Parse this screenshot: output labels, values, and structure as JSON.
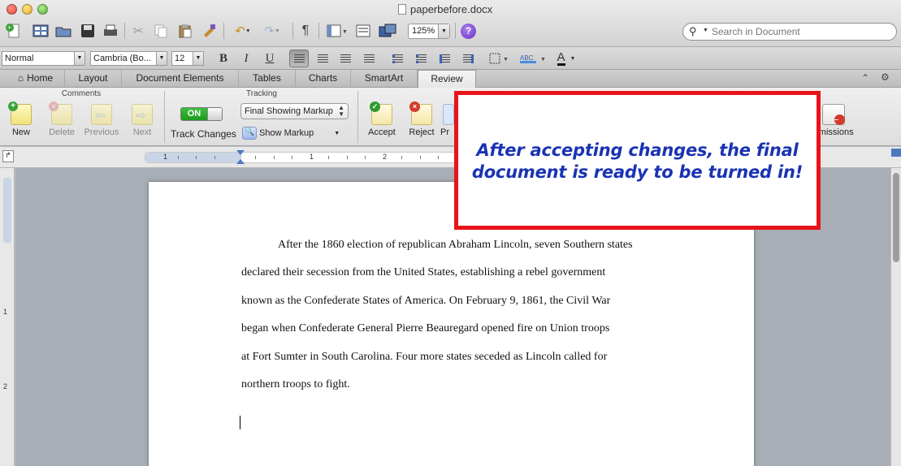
{
  "window": {
    "title": "paperbefore.docx"
  },
  "standard_toolbar": {
    "zoom": "125%",
    "search_placeholder": "Search in Document"
  },
  "formatting_toolbar": {
    "style": "Normal",
    "font": "Cambria (Bo...",
    "size": "12",
    "bold": "B",
    "italic": "I",
    "underline": "U",
    "font_color_letter": "A"
  },
  "tabs": [
    {
      "label": "Home"
    },
    {
      "label": "Layout"
    },
    {
      "label": "Document Elements"
    },
    {
      "label": "Tables"
    },
    {
      "label": "Charts"
    },
    {
      "label": "SmartArt"
    },
    {
      "label": "Review",
      "active": true
    }
  ],
  "ribbon": {
    "comments_label": "Comments",
    "tracking_label": "Tracking",
    "new": "New",
    "delete": "Delete",
    "previous": "Previous",
    "next": "Next",
    "toggle_state": "ON",
    "track_changes": "Track Changes",
    "markup_option": "Final Showing Markup",
    "show_markup": "Show Markup",
    "accept": "Accept",
    "reject": "Reject",
    "previous_truncated": "Pr",
    "permissions_truncated": "ermissions"
  },
  "ruler": {
    "numbers": [
      "1",
      "1",
      "2"
    ]
  },
  "vruler": {
    "numbers": [
      "1",
      "2"
    ]
  },
  "document": {
    "lines": [
      "After the 1860 election of republican Abraham Lincoln, seven Southern states",
      "declared their secession from the United States, establishing a rebel government",
      "known as the Confederate States of America. On February 9, 1861, the Civil War",
      "began when Confederate General Pierre Beauregard opened fire on Union troops",
      "at Fort Sumter in South Carolina. Four more states seceded as Lincoln called for",
      "northern troops to fight."
    ]
  },
  "callout": {
    "line1": "After accepting changes, the final",
    "line2": "document is ready to be turned in!",
    "border_color": "#e8141a",
    "text_color": "#1a33b3"
  },
  "icons": {
    "pilcrow": "¶",
    "help": "?",
    "search": "magnifier-icon"
  }
}
